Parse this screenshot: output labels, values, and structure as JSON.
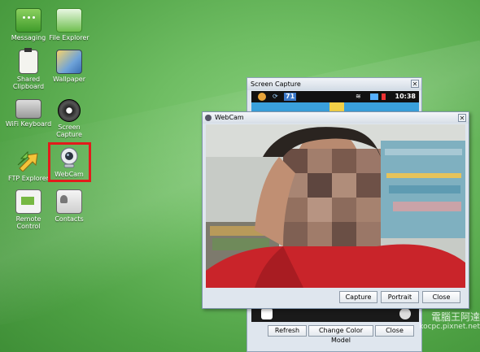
{
  "desktop_icons": [
    {
      "label": "Messaging",
      "icon": "messaging-icon"
    },
    {
      "label": "File Explorer",
      "icon": "file-explorer-icon"
    },
    {
      "label": "Shared Clipboard",
      "icon": "clipboard-icon"
    },
    {
      "label": "Wallpaper",
      "icon": "wallpaper-icon"
    },
    {
      "label": "WiFi Keyboard",
      "icon": "keyboard-icon"
    },
    {
      "label": "Screen Capture",
      "icon": "camera-lens-icon"
    },
    {
      "label": "FTP Explorer",
      "icon": "ftp-arrows-icon"
    },
    {
      "label": "WebCam",
      "icon": "webcam-icon"
    },
    {
      "label": "Remote Control",
      "icon": "remote-control-icon"
    },
    {
      "label": "Contacts",
      "icon": "contacts-icon"
    }
  ],
  "screen_capture": {
    "title": "Screen Capture",
    "status": {
      "badge": "71",
      "time": "10:38"
    },
    "buttons": {
      "refresh": "Refresh",
      "change_color_model": "Change Color Model",
      "close": "Close"
    }
  },
  "webcam": {
    "title": "WebCam",
    "buttons": {
      "capture": "Capture",
      "portrait": "Portrait",
      "close": "Close"
    }
  },
  "watermark": {
    "line1": "電腦王阿達",
    "line2": "kocpc.pixnet.net"
  },
  "colors": {
    "desktop": "#5fb052",
    "highlight": "#e31b1b",
    "titlebar": "#d6dee7",
    "shirt": "#c9242a"
  }
}
